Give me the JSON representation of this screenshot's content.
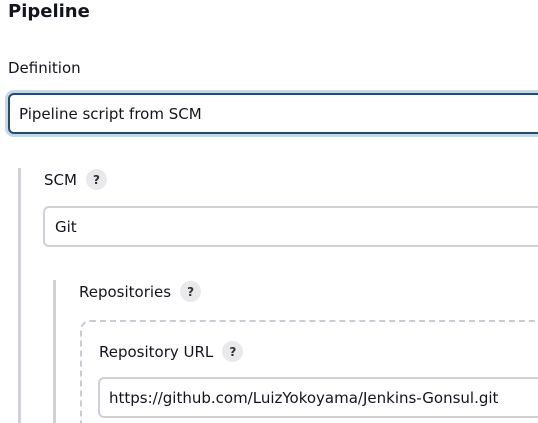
{
  "pipeline": {
    "section_title": "Pipeline",
    "definition_label": "Definition",
    "definition_value": "Pipeline script from SCM",
    "scm": {
      "label": "SCM",
      "help": "?",
      "value": "Git",
      "repositories": {
        "label": "Repositories",
        "help": "?",
        "repository_url_label": "Repository URL",
        "repository_url_help": "?",
        "repository_url_value": "https://github.com/LuizYokoyama/Jenkins-Gonsul.git"
      }
    }
  },
  "colors": {
    "focus_border": "#274a70",
    "focus_ring": "#c5d8ea",
    "input_border": "#cfd1d6",
    "help_bg": "#e9e9ec"
  }
}
